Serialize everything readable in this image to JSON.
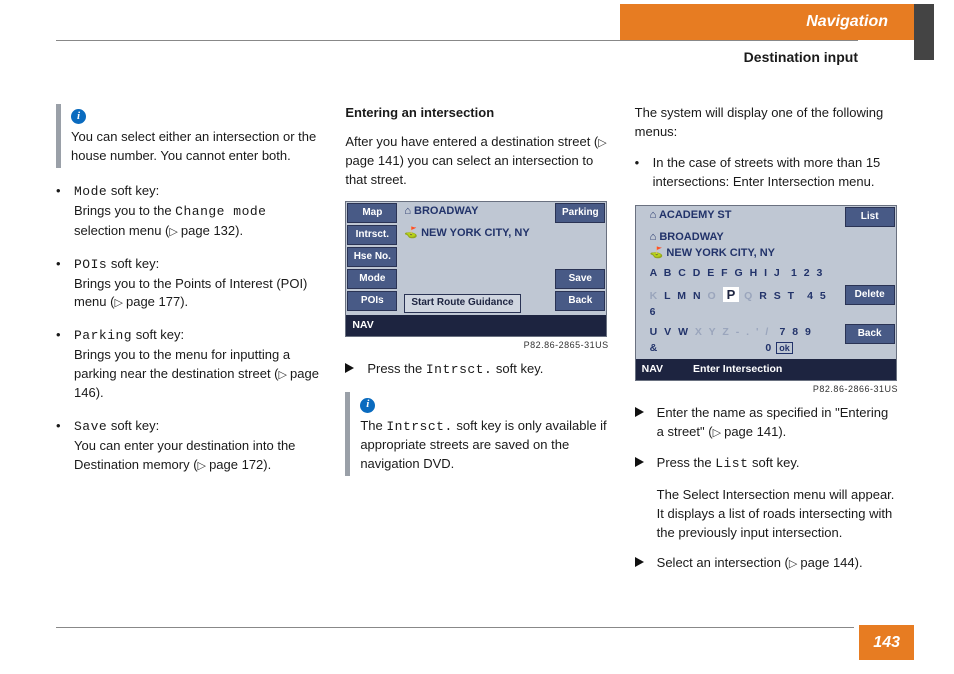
{
  "header": {
    "section": "Navigation",
    "subsection": "Destination input"
  },
  "page_number": "143",
  "col1": {
    "note": "You can select either an intersection or the house number. You cannot enter both.",
    "items": [
      {
        "key": "Mode",
        "tail": " soft key:",
        "body": "Brings you to the ",
        "key2": "Change mode",
        "rest": " selection menu (",
        "pref": "page 132",
        "close": ")."
      },
      {
        "key": "POIs",
        "tail": " soft key:",
        "body": "Brings you to the Points of Interest (POI) menu (",
        "key2": "",
        "rest": "",
        "pref": "page 177",
        "close": ")."
      },
      {
        "key": "Parking",
        "tail": " soft key:",
        "body": "Brings you to the menu for inputting a parking near the destination street (",
        "key2": "",
        "rest": "",
        "pref": "page 146",
        "close": ")."
      },
      {
        "key": "Save",
        "tail": " soft key:",
        "body": "You can enter your destination into the Destination memory (",
        "key2": "",
        "rest": "",
        "pref": "page 172",
        "close": ")."
      }
    ]
  },
  "col2": {
    "heading": "Entering an intersection",
    "intro_a": "After you have entered a destination street (",
    "intro_ref": "page 141",
    "intro_b": ") you can select an intersection to that street.",
    "shot1": {
      "left": [
        "Map",
        "Intrsct.",
        "Hse No.",
        "Mode",
        "POIs"
      ],
      "right": [
        "Parking",
        "",
        "",
        "Save",
        "Back"
      ],
      "line1": "BROADWAY",
      "line2": "NEW YORK CITY, NY",
      "srg": "Start Route Guidance",
      "nav": "NAV",
      "caption": "P82.86-2865-31US"
    },
    "action1_a": "Press the ",
    "action1_key": "Intrsct.",
    "action1_b": " soft key.",
    "note_a": "The ",
    "note_key": "Intrsct.",
    "note_b": " soft key is only available if appropriate streets are saved on the navigation DVD."
  },
  "col3": {
    "lead": "The system will display one of the following menus:",
    "b1": "In the case of streets with more than 15 intersections: Enter Intersection menu.",
    "shot2": {
      "line1": "ACADEMY ST",
      "line2": "BROADWAY",
      "line3": "NEW YORK CITY, NY",
      "kb1": "A B C D E F G H I J",
      "kb1n": "1 2 3",
      "kb2a": "K",
      "kb2b": " L M N ",
      "kb2c": "O",
      "kb2hl": "P",
      "kb2d": "Q",
      "kb2e": " R S T ",
      "kb2n": "4 5 6",
      "kb3a": "U V W ",
      "kb3b": "X Y Z - . ' /",
      "kb3n": "7 8 9",
      "kb4a": "&",
      "kb4n": "0",
      "ok": "ok",
      "right": [
        "List",
        "",
        "",
        "Delete",
        "Back"
      ],
      "nav": "NAV",
      "nav2": "Enter Intersection",
      "caption": "P82.86-2866-31US"
    },
    "a1_a": "Enter the name as specified in \"Entering a street\" (",
    "a1_ref": "page 141",
    "a1_b": ").",
    "a2_a": "Press the ",
    "a2_key": "List",
    "a2_b": " soft key.",
    "p2": "The Select Intersection menu will appear. It displays a list of roads intersecting with the previously input intersection.",
    "a3_a": "Select an intersection (",
    "a3_ref": "page 144",
    "a3_b": ")."
  }
}
